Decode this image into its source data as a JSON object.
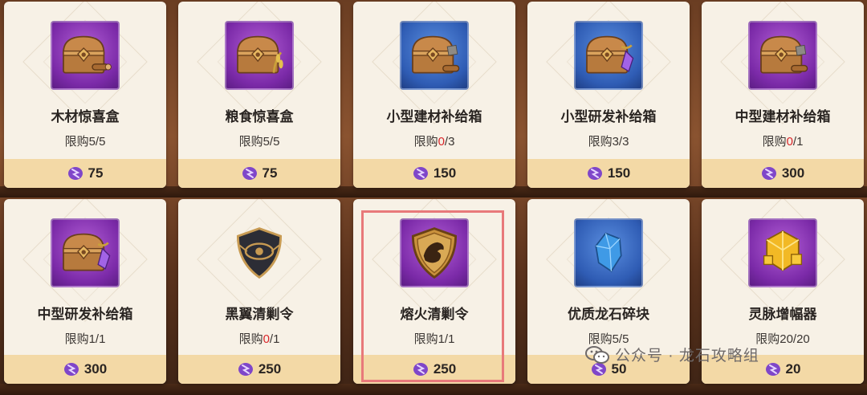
{
  "items": [
    {
      "name": "木材惊喜盒",
      "limit_prefix": "限购",
      "limit_used": "5",
      "limit_sep": "/",
      "limit_total": "5",
      "used_red": false,
      "price": "75",
      "icon": "wood-chest-icon",
      "rarity": "purple"
    },
    {
      "name": "粮食惊喜盒",
      "limit_prefix": "限购",
      "limit_used": "5",
      "limit_sep": "/",
      "limit_total": "5",
      "used_red": false,
      "price": "75",
      "icon": "grain-chest-icon",
      "rarity": "purple"
    },
    {
      "name": "小型建材补给箱",
      "limit_prefix": "限购",
      "limit_used": "0",
      "limit_sep": "/",
      "limit_total": "3",
      "used_red": true,
      "price": "150",
      "icon": "building-chest-icon",
      "rarity": "blue"
    },
    {
      "name": "小型研发补给箱",
      "limit_prefix": "限购",
      "limit_used": "3",
      "limit_sep": "/",
      "limit_total": "3",
      "used_red": false,
      "price": "150",
      "icon": "research-chest-icon",
      "rarity": "blue"
    },
    {
      "name": "中型建材补给箱",
      "limit_prefix": "限购",
      "limit_used": "0",
      "limit_sep": "/",
      "limit_total": "1",
      "used_red": true,
      "price": "300",
      "icon": "building-chest-icon",
      "rarity": "purple"
    },
    {
      "name": "中型研发补给箱",
      "limit_prefix": "限购",
      "limit_used": "1",
      "limit_sep": "/",
      "limit_total": "1",
      "used_red": false,
      "price": "300",
      "icon": "research-chest-icon",
      "rarity": "purple"
    },
    {
      "name": "黑翼清剿令",
      "limit_prefix": "限购",
      "limit_used": "0",
      "limit_sep": "/",
      "limit_total": "1",
      "used_red": true,
      "price": "250",
      "icon": "black-wing-shield-icon",
      "rarity": "none"
    },
    {
      "name": "熔火清剿令",
      "limit_prefix": "限购",
      "limit_used": "1",
      "limit_sep": "/",
      "limit_total": "1",
      "used_red": false,
      "price": "250",
      "icon": "molten-fire-shield-icon",
      "rarity": "purple"
    },
    {
      "name": "优质龙石碎块",
      "limit_prefix": "限购",
      "limit_used": "5",
      "limit_sep": "/",
      "limit_total": "5",
      "used_red": false,
      "price": "50",
      "icon": "dragonstone-fragment-icon",
      "rarity": "blue"
    },
    {
      "name": "灵脉增幅器",
      "limit_prefix": "限购",
      "limit_used": "20",
      "limit_sep": "/",
      "limit_total": "20",
      "used_red": false,
      "price": "20",
      "icon": "spirit-amplifier-icon",
      "rarity": "purple"
    }
  ],
  "currency_icon": "purple-gem-icon",
  "colors": {
    "limit_red": "#d8262a",
    "highlight": "#e8797a",
    "price_bar": "#f3d9a6",
    "card_bg": "#f7f1e6"
  },
  "watermark": {
    "text": "公众号 · 龙石攻略组",
    "icon": "wechat-icon"
  }
}
